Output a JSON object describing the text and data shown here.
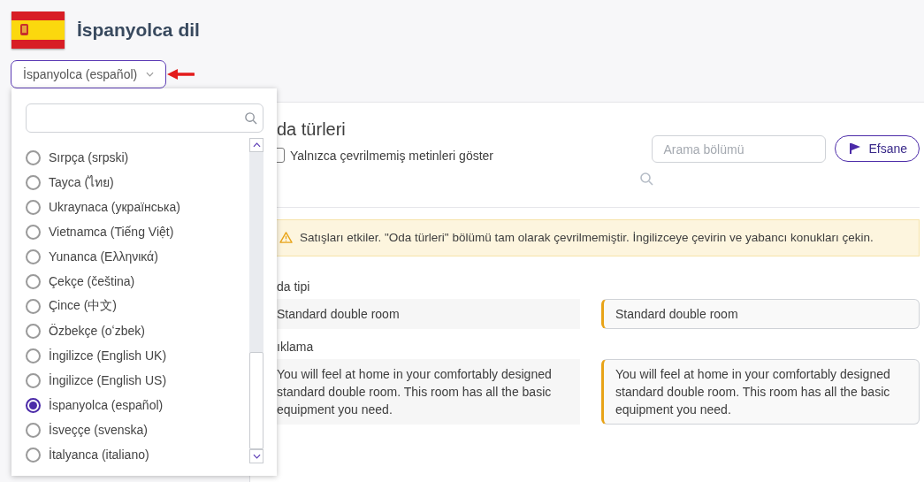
{
  "header": {
    "title": "İspanyolca dil",
    "language_select": "İspanyolca (español)"
  },
  "dropdown": {
    "languages": [
      {
        "label": "Sırpça (srpski)",
        "selected": false
      },
      {
        "label": "Tayca (ไทย)",
        "selected": false
      },
      {
        "label": "Ukraynaca (українська)",
        "selected": false
      },
      {
        "label": "Vietnamca (Tiếng Việt)",
        "selected": false
      },
      {
        "label": "Yunanca (Ελληνικά)",
        "selected": false
      },
      {
        "label": "Çekçe (čeština)",
        "selected": false
      },
      {
        "label": "Çince (中文)",
        "selected": false
      },
      {
        "label": "Özbekçe (oʻzbek)",
        "selected": false
      },
      {
        "label": "İngilizce (English UK)",
        "selected": false
      },
      {
        "label": "İngilizce (English US)",
        "selected": false
      },
      {
        "label": "İspanyolca (español)",
        "selected": true
      },
      {
        "label": "İsveççe (svenska)",
        "selected": false
      },
      {
        "label": "İtalyanca (italiano)",
        "selected": false
      }
    ]
  },
  "section": {
    "title": "da türleri",
    "untranslated_only": {
      "label": "Yalnızca çevrilmemiş metinleri göster",
      "checked": false
    },
    "search": {
      "placeholder": "Arama bölümü"
    },
    "legend_button": "Efsane",
    "warning": "Satışları etkiler. \"Oda türleri\" bölümü tam olarak çevrilmemiştir. İngilizceye çevirin ve yabancı konukları çekin.",
    "fields": [
      {
        "label": "da tipi",
        "source": "Standard double room",
        "translation": "Standard double room"
      },
      {
        "label": "ıklama",
        "source": "You will feel at home in your comfortably designed standard double room. This room has all the basic equipment you need.",
        "translation": "You will feel at home in your comfortably designed standard double room. This room has all the basic equipment you need."
      }
    ]
  }
}
